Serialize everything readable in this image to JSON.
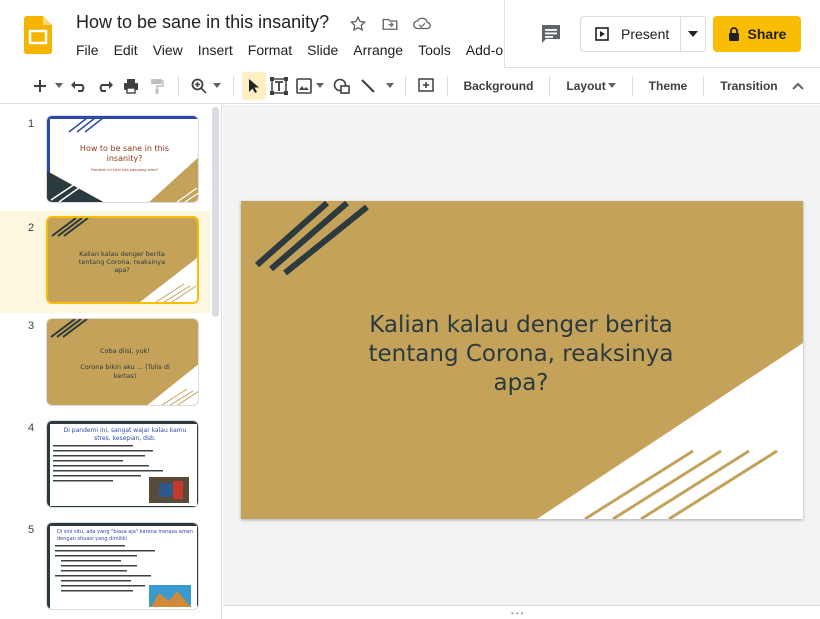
{
  "doc": {
    "title": "How to be sane in this insanity?"
  },
  "menu": [
    "File",
    "Edit",
    "View",
    "Insert",
    "Format",
    "Slide",
    "Arrange",
    "Tools",
    "Add-o"
  ],
  "header": {
    "present_label": "Present",
    "share_label": "Share"
  },
  "toolbar": {
    "background_label": "Background",
    "layout_label": "Layout",
    "theme_label": "Theme",
    "transition_label": "Transition"
  },
  "colors": {
    "accent": "#fbbc04",
    "slide_bg": "#c4a25a",
    "slide_dark": "#2b3a3e",
    "title_text": "#8b3a1a"
  },
  "slides": [
    {
      "num": "1",
      "title": "How to be sane in this insanity?",
      "subtitle": "Pandemi ini bikin kita gampang stres?"
    },
    {
      "num": "2",
      "title": "Kalian kalau denger berita tentang Corona, reaksinya apa?"
    },
    {
      "num": "3",
      "line1": "Coba diisi, yuk!",
      "line2": "Corona bikin aku ... (Tulis di kertas)"
    },
    {
      "num": "4",
      "title": "Di pandemi ini, sangat wajar kalau kamu stres, kesepian, dsb."
    },
    {
      "num": "5",
      "title": "Di sini situ, ada yang \"biasa aja\" karena merasa aman dengan situasi yang dimiliki"
    }
  ],
  "main_slide": {
    "text": "Kalian kalau denger berita tentang Corona, reaksinya apa?"
  }
}
